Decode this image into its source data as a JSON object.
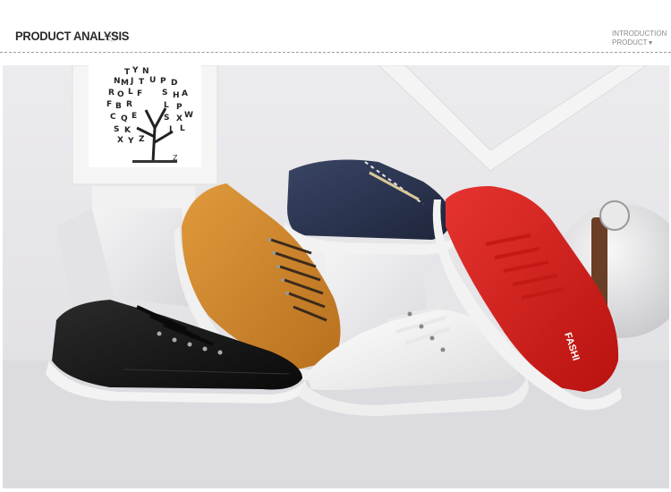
{
  "header": {
    "title": "PRODUCT ANALYSIS",
    "side_label_line1": "INTRODUCTION",
    "side_label_line2": "PRODUCT",
    "side_arrow": "▼"
  },
  "photo": {
    "subject": "shoes-product-photo",
    "frame_letters": [
      "T",
      "Y",
      "N",
      "J",
      "U",
      "V",
      "M",
      "O",
      "B",
      "F",
      "S",
      "R",
      "L",
      "H",
      "A",
      "P",
      "Q",
      "E",
      "K",
      "W",
      "X",
      "D",
      "G",
      "C",
      "Z"
    ],
    "frame_corner_letter": "Z",
    "red_shoe_text": "FASHI"
  },
  "colors": {
    "background": "#e4e3e7",
    "black_shoe": "#151515",
    "tan_shoe": "#d48a2c",
    "navy_shoe": "#2c3550",
    "white_shoe": "#f7f7f7",
    "red_shoe": "#d8201e",
    "sole": "#f2f2f2"
  }
}
